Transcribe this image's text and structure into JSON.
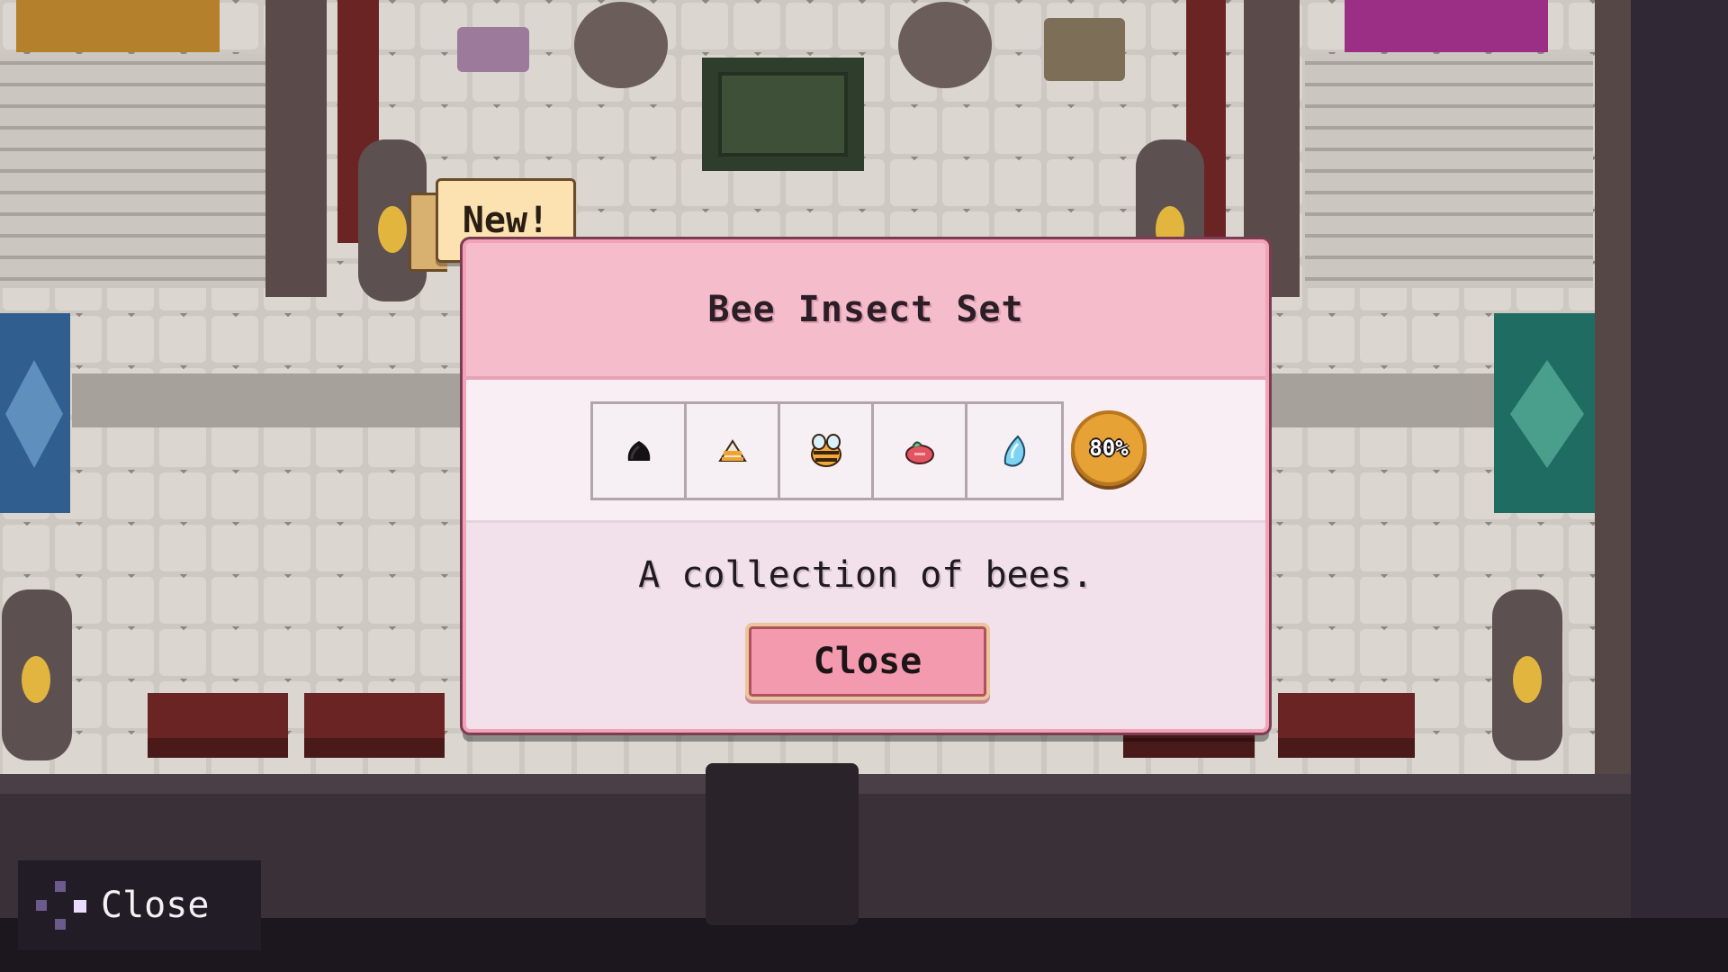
{
  "new_badge": {
    "label": "New!"
  },
  "dialog": {
    "title": "Bee Insect Set",
    "items": [
      {
        "icon": "black-bee-icon"
      },
      {
        "icon": "orange-bee-icon"
      },
      {
        "icon": "honey-bee-icon"
      },
      {
        "icon": "pink-bee-icon"
      },
      {
        "icon": "blue-bee-icon"
      }
    ],
    "completion": {
      "label": "80%",
      "value": 0.8
    },
    "description": "A collection of bees.",
    "close_label": "Close"
  },
  "hint_bar": {
    "icon": "dpad-icon",
    "label": "Close"
  },
  "colors": {
    "dialog_bg": "#f2e0ea",
    "dialog_header": "#f5bccb",
    "button_pink": "#f39aaf",
    "badge_gold": "#e6a235"
  }
}
